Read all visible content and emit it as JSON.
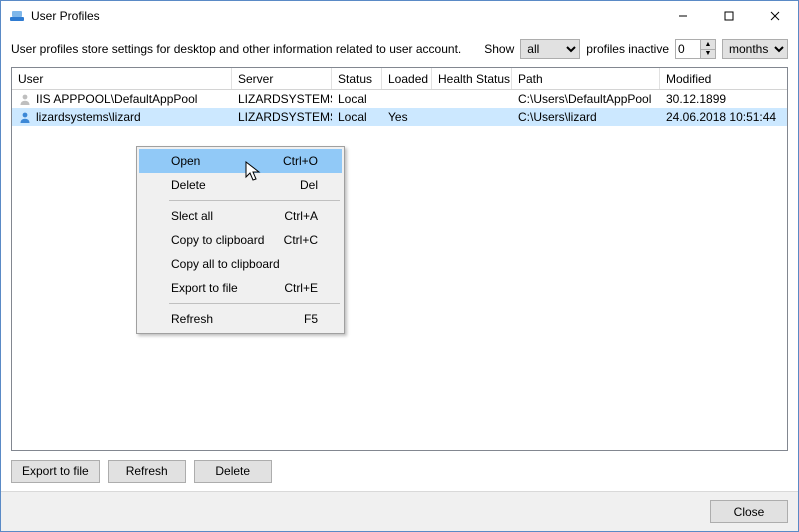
{
  "window": {
    "title": "User Profiles"
  },
  "titlebar_buttons": {
    "min": "minimize",
    "max": "maximize",
    "close": "close"
  },
  "filterbar": {
    "description": "User profiles store settings for desktop and other information related to user account.",
    "show_label": "Show",
    "show_value": "all",
    "inactive_label": "profiles inactive",
    "inactive_value": "0",
    "months_value": "months"
  },
  "grid": {
    "columns": {
      "user": "User",
      "server": "Server",
      "status": "Status",
      "loaded": "Loaded",
      "health": "Health Status",
      "path": "Path",
      "modified": "Modified"
    },
    "rows": [
      {
        "user": "IIS APPPOOL\\DefaultAppPool",
        "server": "LIZARDSYSTEMS",
        "status": "Local",
        "loaded": "",
        "health": "",
        "path": "C:\\Users\\DefaultAppPool",
        "modified": "30.12.1899",
        "icon": "user-gray",
        "selected": false
      },
      {
        "user": "lizardsystems\\lizard",
        "server": "LIZARDSYSTEMS",
        "status": "Local",
        "loaded": "Yes",
        "health": "",
        "path": "C:\\Users\\lizard",
        "modified": "24.06.2018 10:51:44",
        "icon": "user-blue",
        "selected": true
      }
    ]
  },
  "buttons": {
    "export": "Export to file",
    "refresh": "Refresh",
    "delete": "Delete",
    "close": "Close"
  },
  "context_menu": {
    "items": [
      {
        "label": "Open",
        "shortcut": "Ctrl+O",
        "highlight": true
      },
      {
        "label": "Delete",
        "shortcut": "Del"
      },
      {
        "sep": true
      },
      {
        "label": "Slect all",
        "shortcut": "Ctrl+A"
      },
      {
        "label": "Copy to clipboard",
        "shortcut": "Ctrl+C"
      },
      {
        "label": "Copy all to clipboard",
        "shortcut": ""
      },
      {
        "label": "Export to file",
        "shortcut": "Ctrl+E"
      },
      {
        "sep": true
      },
      {
        "label": "Refresh",
        "shortcut": "F5"
      }
    ]
  }
}
